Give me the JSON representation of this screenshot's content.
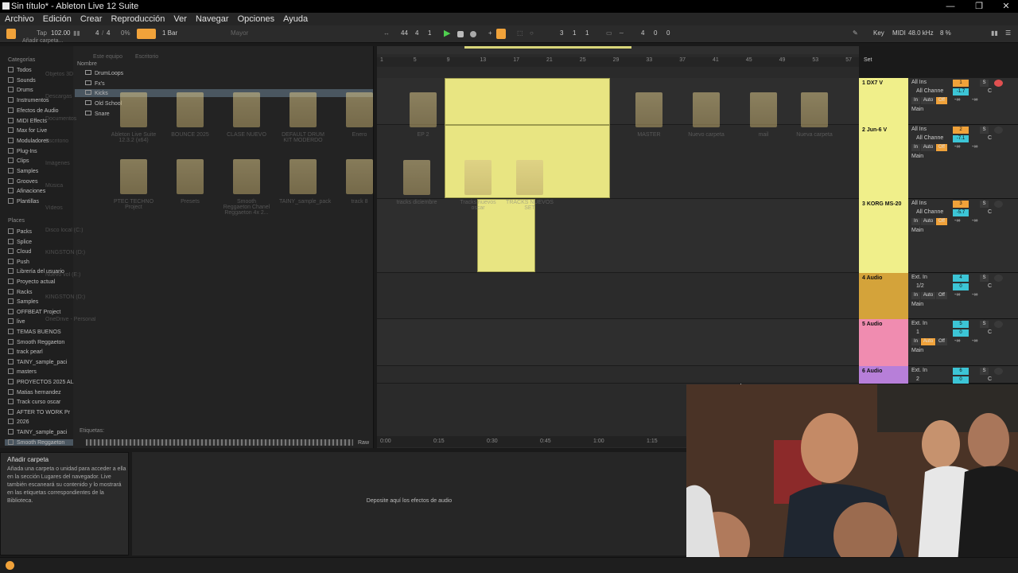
{
  "window": {
    "title": "Sin título* - Ableton Live 12 Suite"
  },
  "menu": [
    "Archivo",
    "Edición",
    "Crear",
    "Reproducción",
    "Ver",
    "Navegar",
    "Opciones",
    "Ayuda"
  ],
  "control": {
    "tap": "Tap",
    "tempo": "102.00",
    "meter_num": "4",
    "meter_den": "4",
    "swing": "0%",
    "quantize": "1 Bar",
    "key": "Mayor",
    "position": [
      "44",
      "4",
      "1"
    ],
    "loop_start": [
      "3",
      "1",
      "1"
    ],
    "loop_len": [
      "4",
      "0",
      "0"
    ],
    "key_label": "Key",
    "midi_label": "MIDI",
    "sample_rate": "48.0 kHz",
    "cpu": "8 %"
  },
  "browser": {
    "add_folder": "Añadir carpeta...",
    "categories_header": "Categorías",
    "categories": [
      "Todos",
      "Sounds",
      "Drums",
      "Instrumentos",
      "Efectos de Audio",
      "MIDI Effects",
      "Max for Live",
      "Moduladores",
      "Plug-Ins",
      "Clips",
      "Samples",
      "Grooves",
      "Afinaciones",
      "Plantillas"
    ],
    "places_header": "Places",
    "places": [
      "Packs",
      "Splice",
      "Cloud",
      "Push",
      "Librería del usuario",
      "Proyecto actual",
      "Racks",
      "Samples",
      "OFFBEAT Project",
      "live",
      "TEMAS BUENOS",
      "Smooth Reggaeton",
      "track pearl",
      "TAINY_sample_paci",
      "masters",
      "PROYECTOS 2025 AL",
      "Matias hernandez",
      "Track curso oscar",
      "AFTER TO WORK Pr",
      "2026",
      "TAINY_sample_paci",
      "Smooth Reggaeton"
    ],
    "name_header": "Nombre",
    "tree": [
      "DrumLoops",
      "Fx's",
      "Kicks",
      "Old School",
      "Snare"
    ],
    "path": [
      "Este equipo",
      "Escritorio"
    ],
    "files_row1": [
      "Ableton Live Suite 12.3.2 (x64)",
      "BOUNCE 2025",
      "CLASE NUEVO",
      "DEFAULT DRUM KIT MODERDO",
      "Enero"
    ],
    "files_row2": [
      "PTEC TECHNO Project",
      "Presets",
      "Smooth Reggaeton Chanel Reggaeton 4x 2...",
      "TAINY_sample_pack",
      "track 8"
    ],
    "ghost_nav": [
      "Objetos 3D",
      "Descargas",
      "Documentos",
      "Escritorio",
      "Imágenes",
      "Música",
      "Vídeos",
      "Disco local (C:)",
      "KINGSTON (D:)",
      "Nuevo vol (E:)",
      "KINGSTON (D:)",
      "OneDrive - Personal"
    ],
    "tags_label": "Etiquetas:",
    "raw_label": "Raw"
  },
  "info": {
    "title": "Añadir carpeta",
    "body": "Añada una carpeta o unidad para acceder a ella en la sección Lugares del navegador. Live también escaneará su contenido y lo mostrará en las etiquetas correspondientes de la Biblioteca."
  },
  "arrangement": {
    "ruler": [
      "1",
      "5",
      "9",
      "13",
      "17",
      "21",
      "25",
      "29",
      "33",
      "37",
      "41",
      "45",
      "49",
      "53",
      "57"
    ],
    "time": [
      "0:00",
      "0:15",
      "0:30",
      "0:45",
      "1:00",
      "1:15"
    ],
    "ghost_files": [
      "EP 2",
      "tracks diciembre",
      "Tracks nuevos oscar",
      "TRACKS NUEVOS SET",
      "MASTER",
      "Nuevo carpeta",
      "mail",
      "Nueva carpeta"
    ],
    "drop_hint": "Deposite aquí los efectos de audio",
    "set_label": "Set"
  },
  "tracks": [
    {
      "name": "1 DX7 V",
      "color": "#f0ef8a",
      "input": "All Ins",
      "channel": "All Channe",
      "num": "1",
      "vol": "-1.7",
      "pan": "C",
      "out": "Main",
      "numcolor": "#f0a23a"
    },
    {
      "name": "2 Jun-6 V",
      "color": "#f0ef8a",
      "input": "All Ins",
      "channel": "All Channe",
      "num": "2",
      "vol": "-7.1",
      "pan": "C",
      "out": "Main",
      "numcolor": "#f0a23a"
    },
    {
      "name": "3 KORG MS-20",
      "color": "#f0ef8a",
      "input": "All Ins",
      "channel": "All Channe",
      "num": "3",
      "vol": "-5.7",
      "pan": "C",
      "out": "Main",
      "numcolor": "#f0a23a"
    },
    {
      "name": "4 Audio",
      "color": "#d4a33a",
      "input": "Ext. In",
      "channel": "1/2",
      "num": "4",
      "vol": "0",
      "pan": "C",
      "out": "Main",
      "numcolor": "#3cc5d6"
    },
    {
      "name": "5 Audio",
      "color": "#f08cb0",
      "input": "Ext. In",
      "channel": "1",
      "num": "5",
      "vol": "0",
      "pan": "C",
      "out": "Main",
      "numcolor": "#3cc5d6"
    },
    {
      "name": "6 Audio",
      "color": "#b77fd9",
      "input": "Ext. In",
      "channel": "2",
      "num": "6",
      "vol": "0",
      "pan": "C",
      "out": "Main",
      "numcolor": "#3cc5d6"
    }
  ],
  "mixer_labels": {
    "in": "In",
    "auto": "Auto",
    "off": "Off",
    "inf": "-∞",
    "solo": "S"
  }
}
